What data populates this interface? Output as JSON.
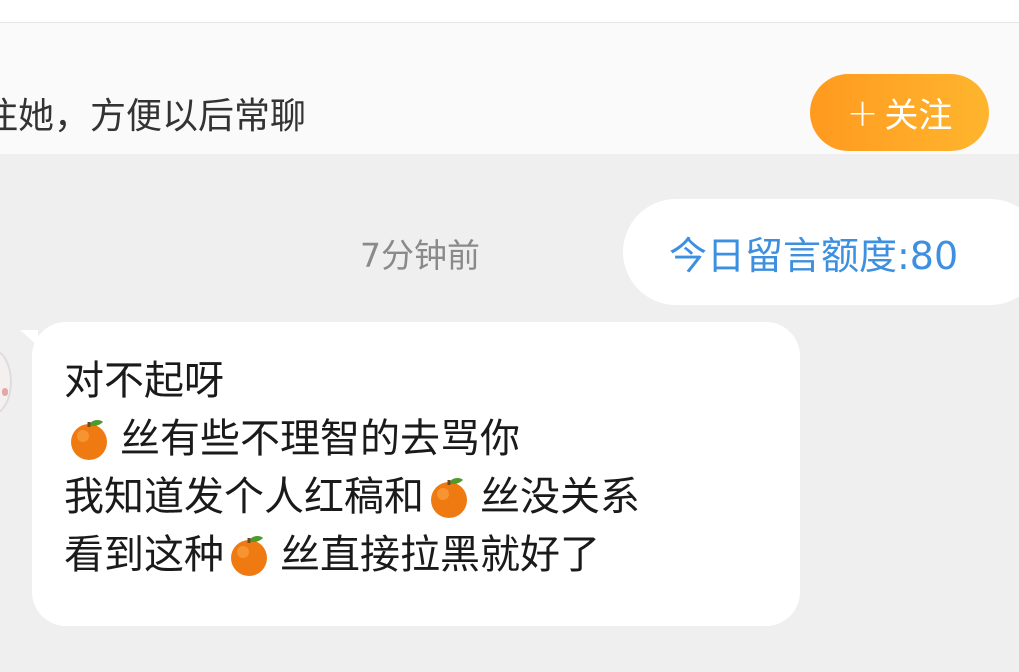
{
  "follow_bar": {
    "prompt_text": "注她，方便以后常聊",
    "follow_button": {
      "plus_symbol": "+",
      "label": "关注"
    }
  },
  "chat": {
    "timestamp": "7分钟前",
    "quota_text": "今日留言额度:80",
    "message": {
      "line1": "对不起呀",
      "line2_after_icon": "丝有些不理智的去骂你",
      "line3_before_icon": "我知道发个人红稿和",
      "line3_after_icon": "丝没关系",
      "line4_before_icon": "看到这种",
      "line4_after_icon": "丝直接拉黑就好了"
    }
  },
  "colors": {
    "accent_orange": "#ff9a1f",
    "quota_blue": "#3d8fe0",
    "chat_background": "#efefef"
  },
  "icons": {
    "orange": "tangerine-icon"
  }
}
